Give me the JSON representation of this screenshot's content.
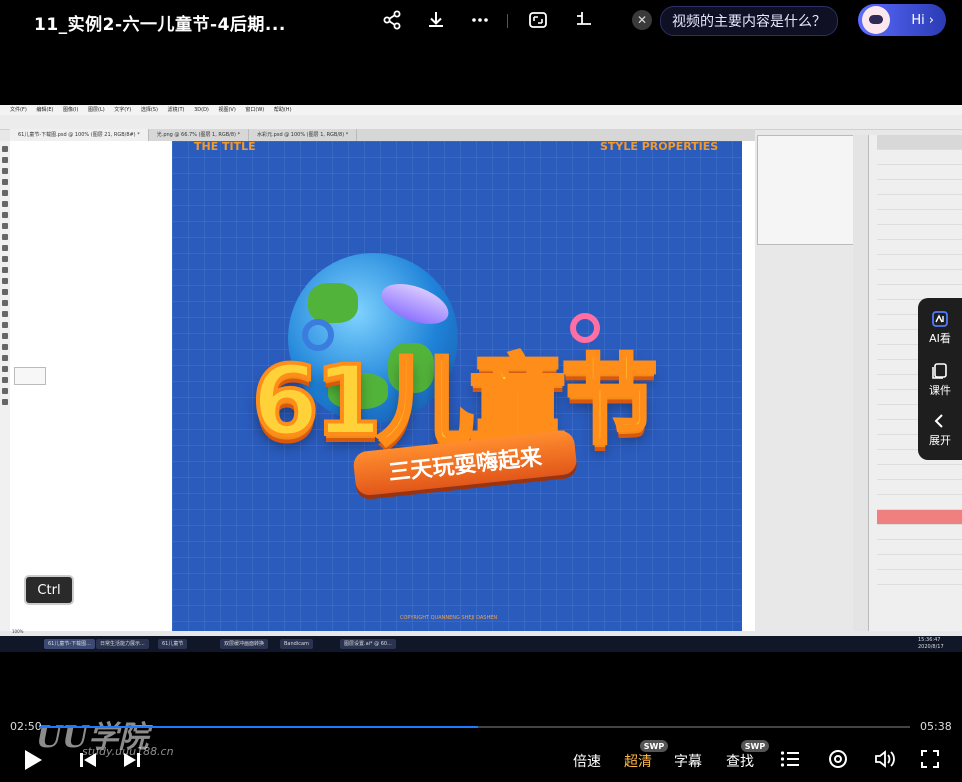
{
  "header": {
    "title": "11_实例2-六一儿童节-4后期...",
    "ai_prompt": "视频的主要内容是什么？",
    "hi_label": "Hi",
    "hi_chevron": "›",
    "close_glyph": "✕",
    "icons": [
      "share-icon",
      "download-icon",
      "more-icon",
      "crop-screen-icon",
      "mini-window-icon"
    ]
  },
  "photoshop": {
    "menu": [
      "文件(F)",
      "编辑(E)",
      "图像(I)",
      "图层(L)",
      "文字(Y)",
      "选择(S)",
      "滤镜(T)",
      "3D(D)",
      "视图(V)",
      "窗口(W)",
      "帮助(H)"
    ],
    "tabs": [
      "61儿童节-下载图.psd @ 100% (图层 21, RGB/8#) *",
      "光.png @ 66.7% (图层 1, RGB/8) *",
      "水彩元.psd @ 100% (图层 1, RGB/8) *"
    ],
    "artboard": {
      "title_left": "THE TITLE",
      "title_right": "STYLE PROPERTIES",
      "main_text": "61儿童节",
      "ribbon_text": "三天玩耍嗨起来",
      "copyright": "COPYRIGHT QUANNENG SHEJI DASHEN"
    },
    "zoom": "100%"
  },
  "ctrl_key": "Ctrl",
  "taskbar": {
    "items": [
      "61儿童节-下载图...",
      "日常生活能力展示...",
      "61儿童节",
      "双层缓冲画面转换",
      "Bandicam",
      "图层设置.ai* @ 60..."
    ],
    "clock": "15:36:47",
    "date": "2020/8/17"
  },
  "side_panel": {
    "items": [
      {
        "label": "AI看",
        "icon": "ai-watch-icon"
      },
      {
        "label": "课件",
        "icon": "courseware-icon"
      },
      {
        "label": "展开",
        "icon": "expand-chevron-icon"
      }
    ]
  },
  "player": {
    "current_time": "02:50",
    "total_time": "05:38",
    "progress": 0.503,
    "watermark": "UU学院",
    "watermark_sub": "study.uuu188.cn",
    "controls": {
      "speed": "倍速",
      "quality": "超清",
      "subtitle": "字幕",
      "search": "查找",
      "badge": "SWP"
    },
    "accent": "#1d7bff"
  }
}
